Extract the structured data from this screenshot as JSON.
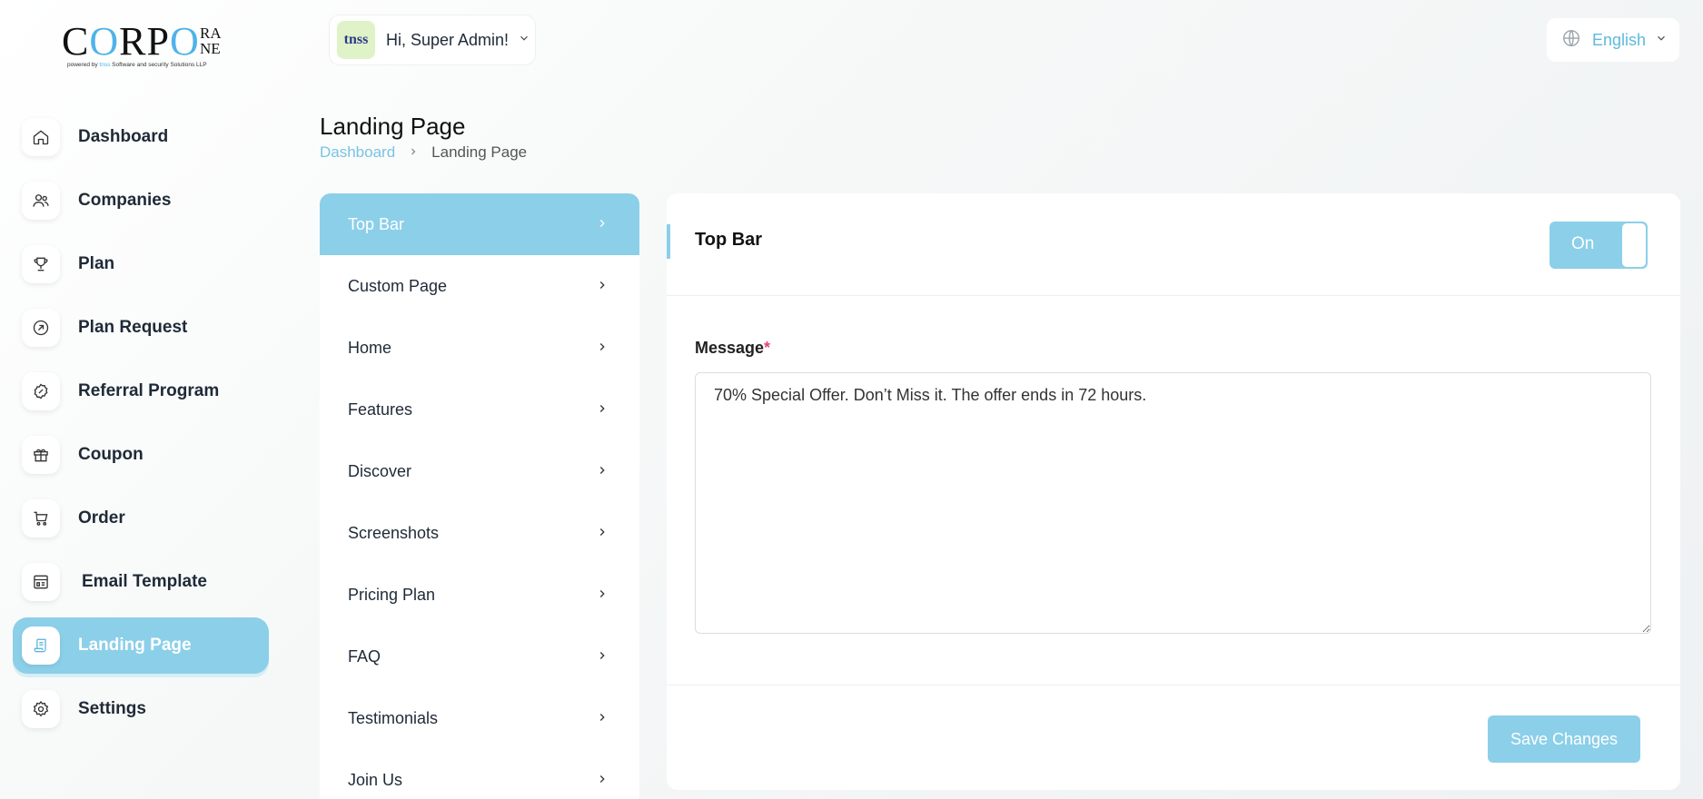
{
  "brand": {
    "logo_main": "CORPO",
    "logo_stack_top": "RA",
    "logo_stack_bottom": "NE",
    "logo_sub_prefix": "powered by ",
    "logo_sub_highlight": "tnss",
    "logo_sub_suffix": " Software and security Solutions LLP",
    "accent_color": "#8ccfe9"
  },
  "header": {
    "avatar_text": "tnss",
    "greeting": "Hi, Super Admin!",
    "language": "English"
  },
  "sidebar": {
    "items": [
      {
        "label": "Dashboard",
        "icon": "home-icon"
      },
      {
        "label": "Companies",
        "icon": "users-icon"
      },
      {
        "label": "Plan",
        "icon": "trophy-icon"
      },
      {
        "label": "Plan Request",
        "icon": "arrow-circle-icon"
      },
      {
        "label": "Referral Program",
        "icon": "badge-icon"
      },
      {
        "label": "Coupon",
        "icon": "gift-icon"
      },
      {
        "label": "Order",
        "icon": "cart-icon"
      },
      {
        "label": "Email Template",
        "icon": "template-icon"
      },
      {
        "label": "Landing Page",
        "icon": "scroll-icon",
        "active": true
      },
      {
        "label": "Settings",
        "icon": "gear-icon"
      }
    ]
  },
  "page": {
    "title": "Landing Page",
    "breadcrumb_root": "Dashboard",
    "breadcrumb_current": "Landing Page"
  },
  "sections": {
    "items": [
      {
        "label": "Top Bar",
        "active": true
      },
      {
        "label": "Custom Page"
      },
      {
        "label": "Home"
      },
      {
        "label": "Features"
      },
      {
        "label": "Discover"
      },
      {
        "label": "Screenshots"
      },
      {
        "label": "Pricing Plan"
      },
      {
        "label": "FAQ"
      },
      {
        "label": "Testimonials"
      },
      {
        "label": "Join Us"
      }
    ]
  },
  "card": {
    "title": "Top Bar",
    "toggle_label": "On",
    "message_label": "Message",
    "required_mark": "*",
    "message_value": "70% Special Offer. Don’t Miss it. The offer ends in 72 hours.",
    "save_label": "Save Changes"
  }
}
